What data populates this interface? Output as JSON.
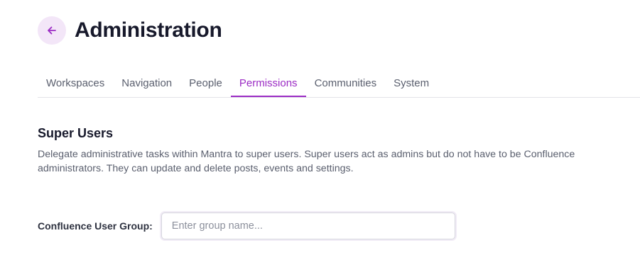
{
  "header": {
    "title": "Administration",
    "back_icon": "arrow-left-icon"
  },
  "tabs": [
    {
      "label": "Workspaces",
      "active": false
    },
    {
      "label": "Navigation",
      "active": false
    },
    {
      "label": "People",
      "active": false
    },
    {
      "label": "Permissions",
      "active": true
    },
    {
      "label": "Communities",
      "active": false
    },
    {
      "label": "System",
      "active": false
    }
  ],
  "section": {
    "title": "Super Users",
    "description": "Delegate administrative tasks within Mantra to super users. Super users act as admins but do not have to be Confluence administrators. They can update and delete posts, events and settings."
  },
  "group_field": {
    "label": "Confluence User Group:",
    "value": "",
    "placeholder": "Enter group name..."
  },
  "colors": {
    "accent": "#9b2bc4",
    "back_button_bg": "#f3e6f8"
  }
}
